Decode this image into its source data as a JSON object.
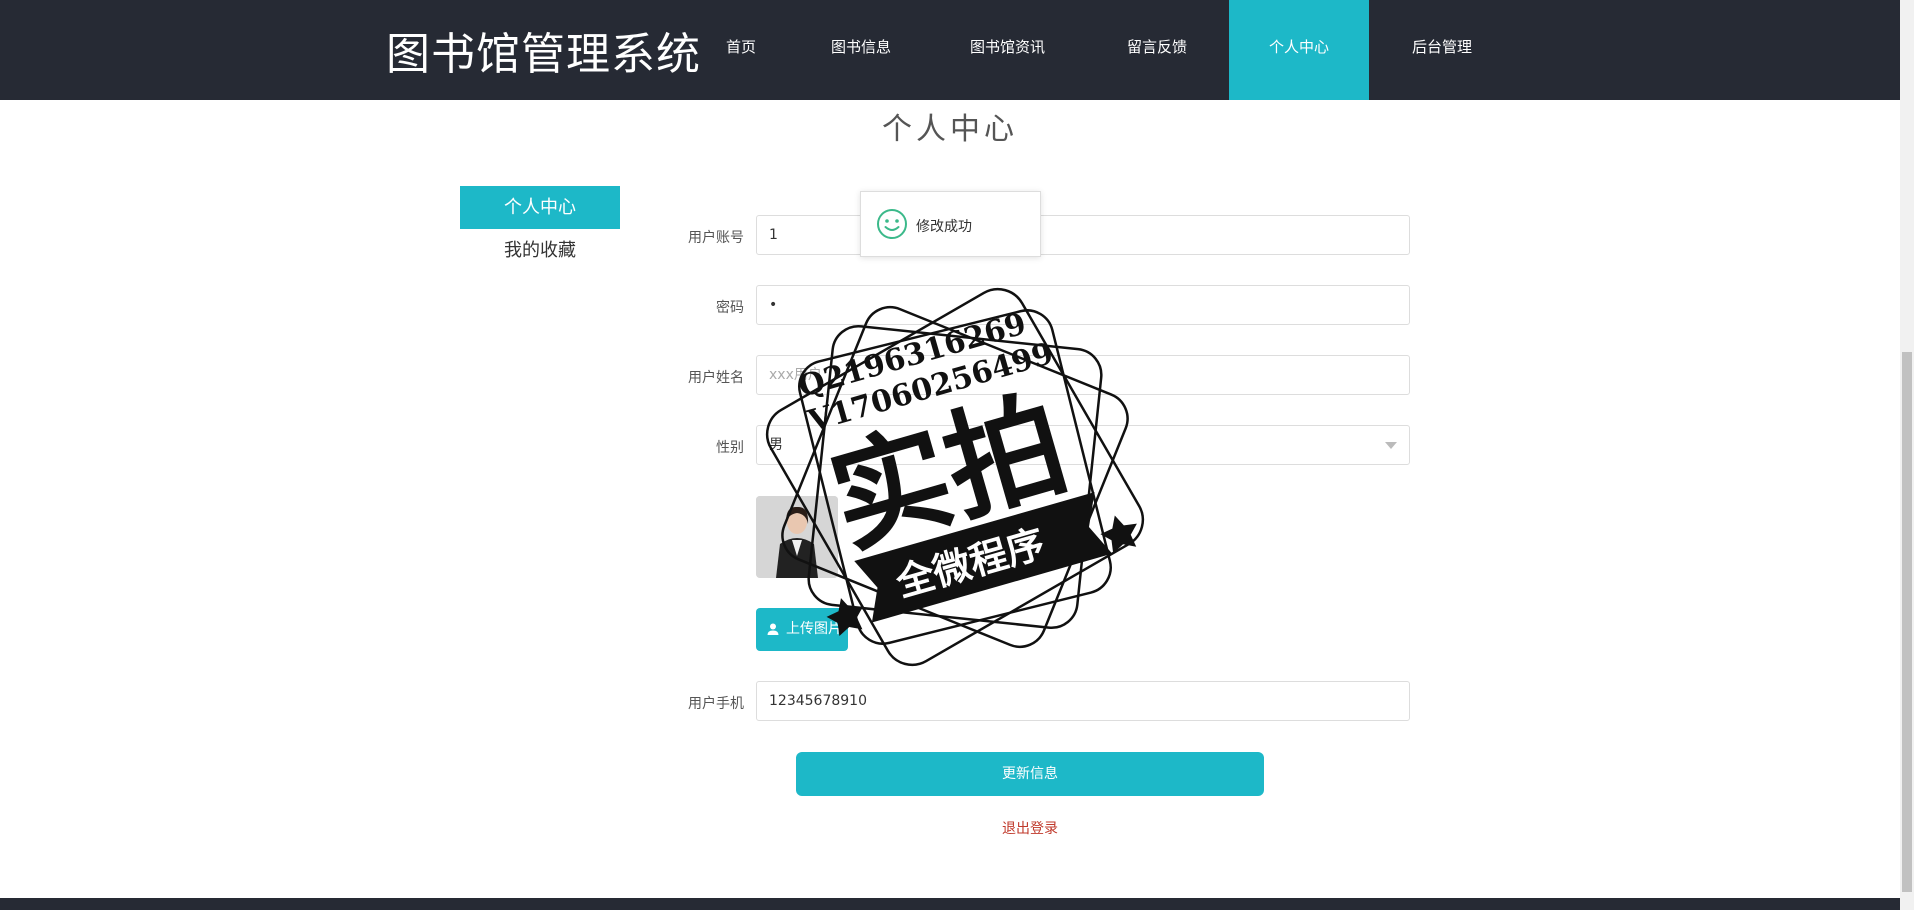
{
  "header": {
    "brand": "图书馆管理系统",
    "nav": [
      {
        "label": "首页",
        "active": false
      },
      {
        "label": "图书信息",
        "active": false
      },
      {
        "label": "图书馆资讯",
        "active": false
      },
      {
        "label": "留言反馈",
        "active": false
      },
      {
        "label": "个人中心",
        "active": true
      },
      {
        "label": "后台管理",
        "active": false
      }
    ]
  },
  "page": {
    "title": "个人中心"
  },
  "sidebar": {
    "items": [
      {
        "label": "个人中心"
      },
      {
        "label": "我的收藏"
      }
    ]
  },
  "form": {
    "account": {
      "label": "用户账号",
      "value": "1"
    },
    "password": {
      "label": "密码",
      "value": "•"
    },
    "name": {
      "label": "用户姓名",
      "placeholder": "xxx用户"
    },
    "gender": {
      "label": "性别",
      "value": "男"
    },
    "upload_label": "上传图片",
    "phone": {
      "label": "用户手机",
      "value": "12345678910"
    },
    "submit_label": "更新信息",
    "logout_label": "退出登录"
  },
  "toast": {
    "message": "修改成功",
    "icon": "smile-icon"
  },
  "watermark": {
    "line1": "Q2196316269",
    "line2": "V17060256499",
    "main": "实拍",
    "ribbon": "全微程序"
  },
  "colors": {
    "accent": "#1db8c8",
    "header": "#262a34",
    "logout": "#c0392b"
  }
}
